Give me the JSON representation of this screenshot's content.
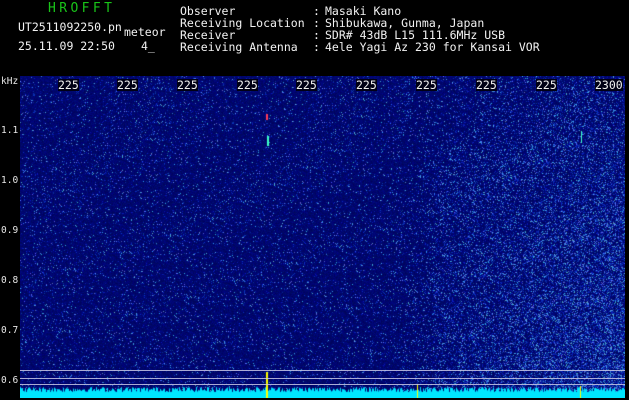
{
  "header": {
    "app_title": "HROFFT",
    "file_name": "UT2511092250.pn",
    "tag": "meteor",
    "date_time": "25.11.09 22:50",
    "count": "4_",
    "info": [
      {
        "label": "Observer",
        "value": "Masaki Kano"
      },
      {
        "label": "Receiving Location",
        "value": "Shibukawa, Gunma, Japan"
      },
      {
        "label": "Receiver",
        "value": "SDR# 43dB L15 111.6MHz USB"
      },
      {
        "label": "Receiving Antenna",
        "value": "4ele Yagi Az 230 for Kansai VOR"
      }
    ]
  },
  "spectrogram": {
    "unit": "kHz",
    "y_labels": [
      "1.1",
      "1.0",
      "0.9",
      "0.8",
      "0.7",
      "0.6"
    ],
    "x_labels": [
      "225",
      "225",
      "225",
      "225",
      "225",
      "225",
      "225",
      "225",
      "225",
      "2300"
    ],
    "colors": {
      "background": "#00006e",
      "noise": "#3c64ff",
      "baseline": "#00e6ff",
      "signal": "#ffff00"
    }
  }
}
